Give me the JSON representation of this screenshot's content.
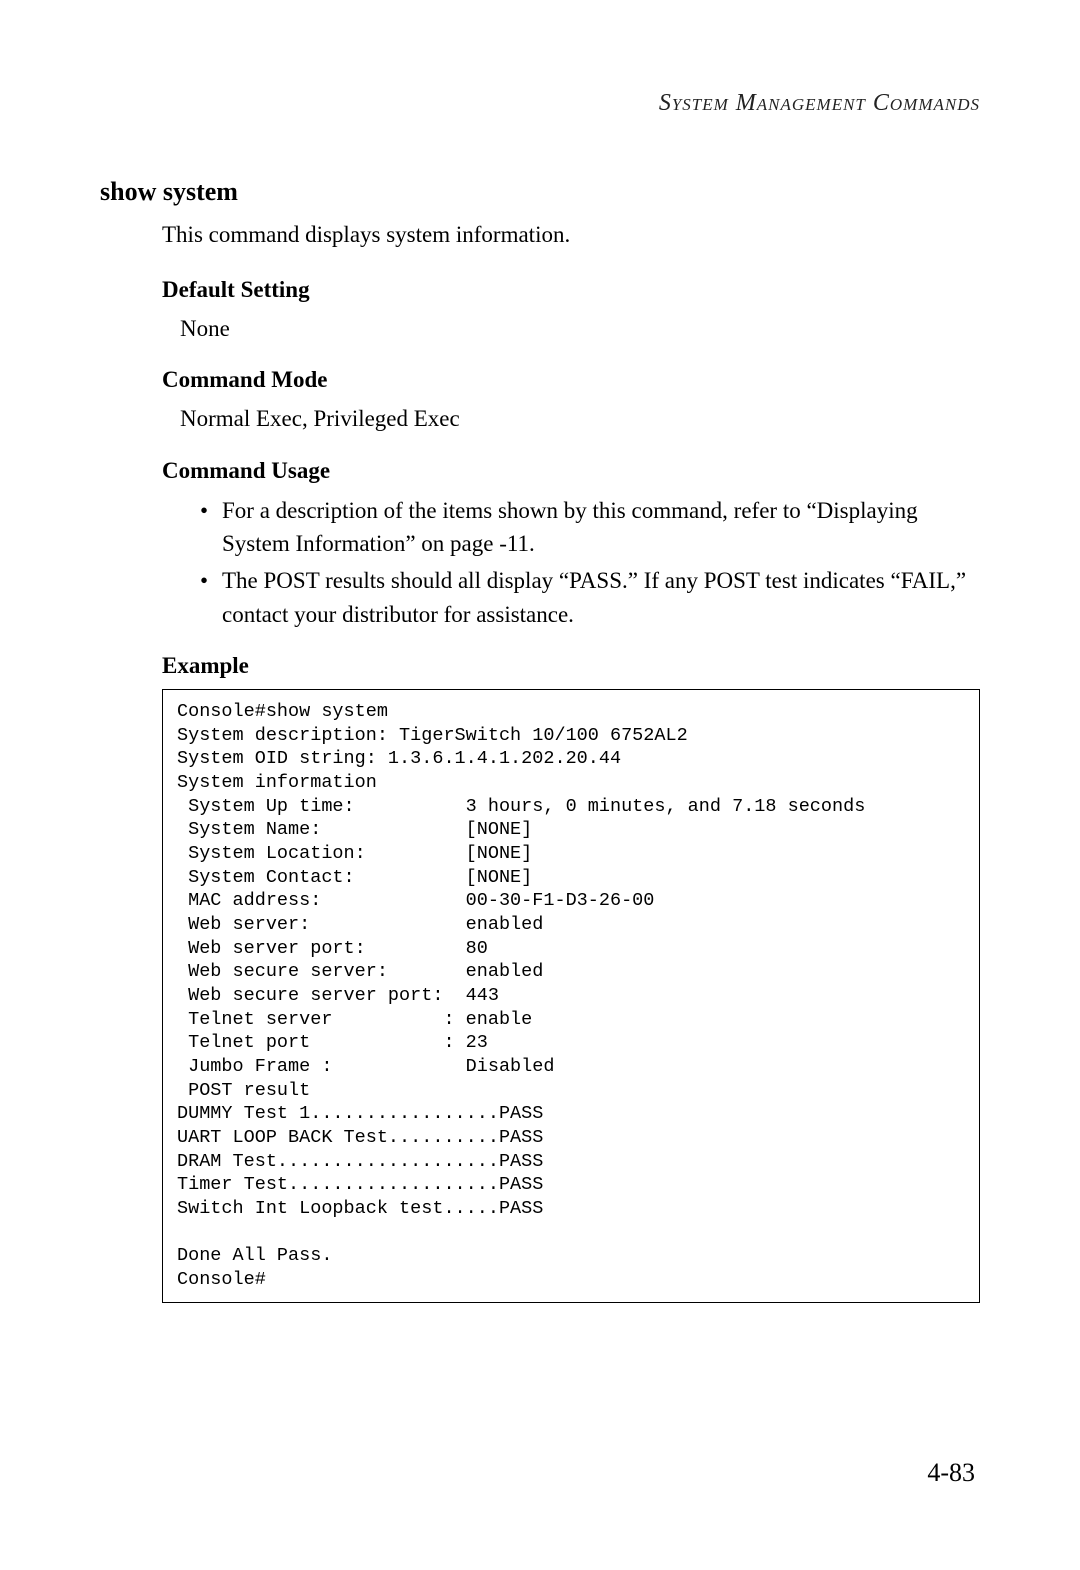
{
  "header": "System Management Commands",
  "command_title": "show system",
  "intro": "This command displays system information.",
  "sections": {
    "default_setting": {
      "title": "Default Setting",
      "body": "None"
    },
    "command_mode": {
      "title": "Command Mode",
      "body": "Normal Exec, Privileged Exec"
    },
    "command_usage": {
      "title": "Command Usage",
      "items": [
        "For a description of the items shown by this command, refer to “Displaying System Information” on page -11.",
        "The POST results should all display “PASS.” If any POST test indicates “FAIL,” contact your distributor for assistance."
      ]
    },
    "example": {
      "title": "Example",
      "code": "Console#show system\nSystem description: TigerSwitch 10/100 6752AL2\nSystem OID string: 1.3.6.1.4.1.202.20.44\nSystem information\n System Up time:          3 hours, 0 minutes, and 7.18 seconds\n System Name:             [NONE]\n System Location:         [NONE]\n System Contact:          [NONE]\n MAC address:             00-30-F1-D3-26-00\n Web server:              enabled\n Web server port:         80\n Web secure server:       enabled\n Web secure server port:  443\n Telnet server          : enable\n Telnet port            : 23\n Jumbo Frame :            Disabled\n POST result\nDUMMY Test 1.................PASS\nUART LOOP BACK Test..........PASS\nDRAM Test....................PASS\nTimer Test...................PASS\nSwitch Int Loopback test.....PASS\n\nDone All Pass.\nConsole#"
    }
  },
  "page_number": "4-83"
}
